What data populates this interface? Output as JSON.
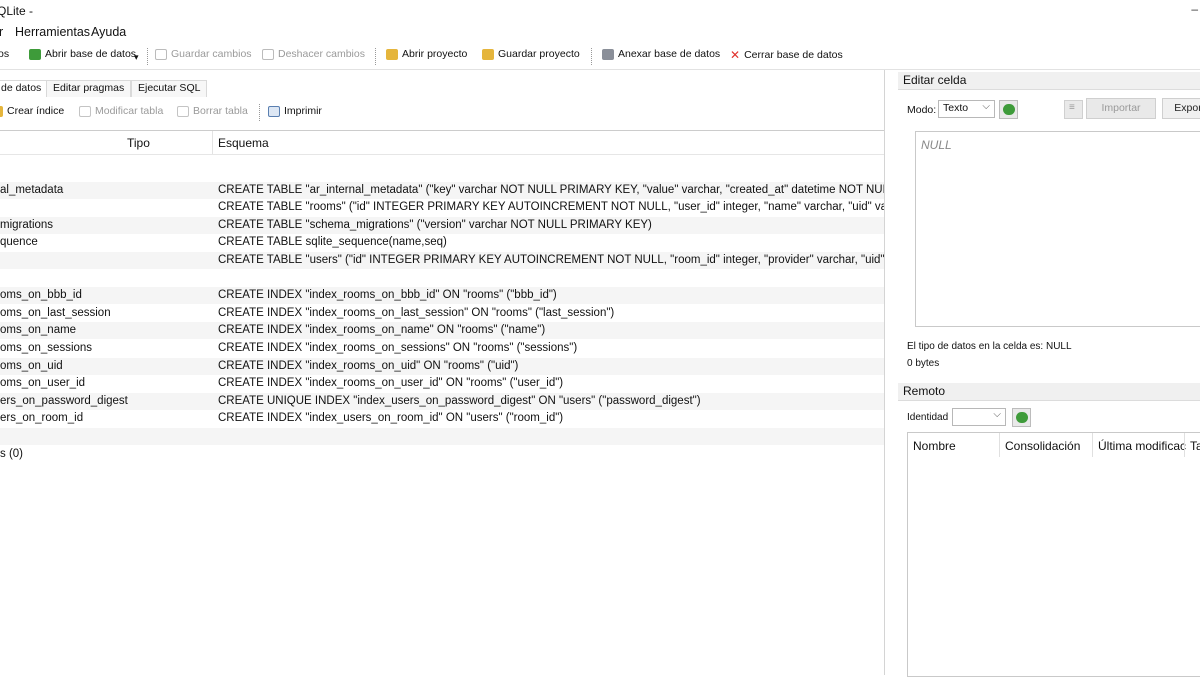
{
  "window": {
    "title": "QLite -",
    "minimize_glyph": "–"
  },
  "menu": [
    "r",
    "Herramientas",
    "Ayuda"
  ],
  "toolbar": {
    "items": [
      {
        "label": "os",
        "disabled": false
      },
      {
        "label": "Abrir base de datos",
        "disabled": false,
        "icon": "open-db-icon"
      },
      {
        "label": "Guardar cambios",
        "disabled": true,
        "icon": "save-icon"
      },
      {
        "label": "Deshacer cambios",
        "disabled": true,
        "icon": "undo-icon"
      },
      {
        "label": "Abrir proyecto",
        "disabled": false,
        "icon": "open-project-icon"
      },
      {
        "label": "Guardar proyecto",
        "disabled": false,
        "icon": "save-project-icon"
      },
      {
        "label": "Anexar base de datos",
        "disabled": false,
        "icon": "attach-db-icon"
      },
      {
        "label": "Cerrar base de datos",
        "disabled": false,
        "icon": "close-db-icon"
      }
    ]
  },
  "tabs": [
    {
      "label": "de datos",
      "active": true
    },
    {
      "label": "Editar pragmas",
      "active": false
    },
    {
      "label": "Ejecutar SQL",
      "active": false
    }
  ],
  "structure_toolbar": {
    "create_index": "Crear índice",
    "modify_table": "Modificar tabla",
    "delete_table": "Borrar tabla",
    "print": "Imprimir"
  },
  "grid": {
    "headers": {
      "type": "Tipo",
      "schema": "Esquema"
    },
    "rows": [
      {
        "name": "",
        "schema": ""
      },
      {
        "name": "al_metadata",
        "schema": "CREATE TABLE \"ar_internal_metadata\" (\"key\" varchar NOT NULL PRIMARY KEY, \"value\" varchar, \"created_at\" datetime NOT NULL, \"updated_at\" datetime NOT NULL)"
      },
      {
        "name": "",
        "schema": "CREATE TABLE \"rooms\" (\"id\" INTEGER PRIMARY KEY AUTOINCREMENT NOT NULL, \"user_id\" integer, \"name\" varchar, \"uid\" varchar, \"bbb_id\" varchar)"
      },
      {
        "name": "migrations",
        "schema": "CREATE TABLE \"schema_migrations\" (\"version\" varchar NOT NULL PRIMARY KEY)"
      },
      {
        "name": "quence",
        "schema": "CREATE TABLE sqlite_sequence(name,seq)"
      },
      {
        "name": "",
        "schema": "CREATE TABLE \"users\" (\"id\" INTEGER PRIMARY KEY AUTOINCREMENT NOT NULL, \"room_id\" integer, \"provider\" varchar, \"uid\" varchar, \"name\" varchar)"
      },
      {
        "name": "",
        "schema": ""
      },
      {
        "name": "oms_on_bbb_id",
        "schema": "CREATE INDEX \"index_rooms_on_bbb_id\" ON \"rooms\" (\"bbb_id\")"
      },
      {
        "name": "oms_on_last_session",
        "schema": "CREATE INDEX \"index_rooms_on_last_session\" ON \"rooms\" (\"last_session\")"
      },
      {
        "name": "oms_on_name",
        "schema": "CREATE INDEX \"index_rooms_on_name\" ON \"rooms\" (\"name\")"
      },
      {
        "name": "oms_on_sessions",
        "schema": "CREATE INDEX \"index_rooms_on_sessions\" ON \"rooms\" (\"sessions\")"
      },
      {
        "name": "oms_on_uid",
        "schema": "CREATE INDEX \"index_rooms_on_uid\" ON \"rooms\" (\"uid\")"
      },
      {
        "name": "oms_on_user_id",
        "schema": "CREATE INDEX \"index_rooms_on_user_id\" ON \"rooms\" (\"user_id\")"
      },
      {
        "name": "ers_on_password_digest",
        "schema": "CREATE UNIQUE INDEX \"index_users_on_password_digest\" ON \"users\" (\"password_digest\")"
      },
      {
        "name": "ers_on_room_id",
        "schema": "CREATE INDEX \"index_users_on_room_id\" ON \"users\" (\"room_id\")"
      },
      {
        "name": "",
        "schema": ""
      },
      {
        "name": "s (0)",
        "schema": ""
      }
    ]
  },
  "edit_cell": {
    "title": "Editar celda",
    "mode_label": "Modo:",
    "mode_value": "Texto",
    "import_label": "Importar",
    "export_label": "Expor",
    "content": "NULL",
    "type_info": "El tipo de datos en la celda es: NULL",
    "size_info": "0 bytes"
  },
  "remote": {
    "title": "Remoto",
    "identity_label": "Identidad",
    "identity_value": "",
    "columns": [
      "Nombre",
      "Consolidación",
      "Última modificac",
      "Ta"
    ]
  },
  "colors": {
    "accent_green": "#3e9b3a",
    "close_red": "#e0322d",
    "folder_yellow": "#e5b53c",
    "disabled_text": "#9a9a9a"
  }
}
